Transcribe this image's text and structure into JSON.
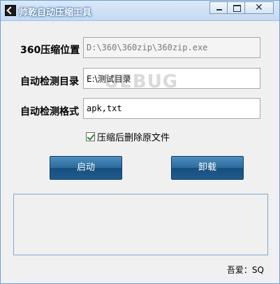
{
  "window": {
    "title": "帅乾自动压缩工具",
    "controls": {
      "minimize": "minimize",
      "maximize": "maximize",
      "close": "✕"
    }
  },
  "form": {
    "path_label": "360压缩位置",
    "path_value": "D:\\360\\360zip\\360zip.exe",
    "dir_label": "自动检测目录",
    "dir_value": "E:\\测试目录",
    "format_label": "自动检测格式",
    "format_value": "apk,txt"
  },
  "options": {
    "delete_original_label": "压缩后删除原文件",
    "delete_original_checked": true
  },
  "buttons": {
    "start": "启动",
    "uninstall": "卸载"
  },
  "log": {
    "text": ""
  },
  "footer": {
    "text": "吾爱：SQ"
  },
  "watermark": {
    "text": "UEBUG"
  },
  "icons": {
    "app": "app-icon",
    "minimize": "minimize-icon",
    "maximize": "maximize-icon",
    "close": "close-icon",
    "checkbox": "checkmark-icon"
  }
}
